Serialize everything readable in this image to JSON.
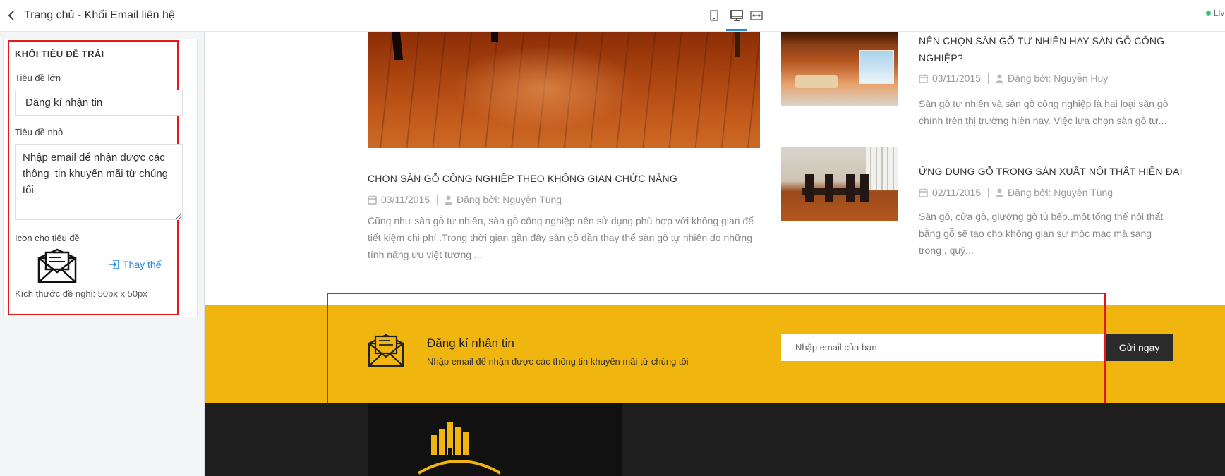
{
  "editor": {
    "header_title": "Trang chủ - Khối Email liên hệ",
    "section_heading": "KHỐI TIÊU ĐỀ TRÁI",
    "big_title_label": "Tiêu đề lớn",
    "big_title_value": "Đăng kí nhận tin",
    "small_title_label": "Tiêu đề nhỏ",
    "small_title_value": "Nhập email để nhận được các thông  tin khuyến mãi từ chúng tôi",
    "icon_label": "Icon cho tiêu đề",
    "replace_label": "Thay thế",
    "size_hint": "Kích thước đề nghị: 50px x 50px"
  },
  "toolbar": {
    "devices": [
      "mobile-icon",
      "desktop-icon",
      "fullwidth-icon"
    ],
    "active_device": "desktop",
    "live_label": "Liv"
  },
  "posts": [
    {
      "title": "CHỌN SÀN GỖ CÔNG NGHIỆP THEO KHÔNG GIAN CHỨC NĂNG",
      "date": "03/11/2015",
      "author": "Đăng bởi: Nguyễn Tùng",
      "excerpt": "Cũng như sàn gỗ tự nhiên, sàn gỗ công nghiệp nên sử dụng phù hợp với không gian để tiết kiệm chi phí .Trong thời gian gần đây sàn gỗ dần thay thế sàn gỗ tự nhiên do những tính năng ưu việt tương ..."
    },
    {
      "title": "NÊN CHỌN SÀN GỖ TỰ NHIÊN HAY SÀN GỖ CÔNG NGHIỆP?",
      "date": "03/11/2015",
      "author": "Đăng bởi: Nguyễn Huy",
      "excerpt": "Sàn gỗ tự nhiên và sàn gỗ công nghiệp là hai loại sàn gỗ chính trên thị trường hiện nay. Việc lựa chọn sàn gỗ tự..."
    },
    {
      "title": "ỨNG DỤNG GỖ TRONG SẢN XUẤT NỘI THẤT HIỆN ĐẠI",
      "date": "02/11/2015",
      "author": "Đăng bởi: Nguyễn Tùng",
      "excerpt": "Sàn gỗ, cửa gỗ, giường gỗ tủ bếp..một tổng thể nội thất bằng gỗ sẽ tạo cho không gian sự mộc mạc mà sang trọng , quý..."
    }
  ],
  "newsletter": {
    "title": "Đăng kí nhận tin",
    "subtitle": "Nhập email để nhận được các thông tin khuyến mãi từ chúng tôi",
    "email_placeholder": "Nhập email của bạn",
    "submit_label": "Gửi ngay"
  },
  "colors": {
    "band": "#f0b50f",
    "highlight_box": "#e8151b",
    "accent": "#1e88e5",
    "submit_bg": "#2b2b2b",
    "footer_bg": "#1e1e1e"
  }
}
